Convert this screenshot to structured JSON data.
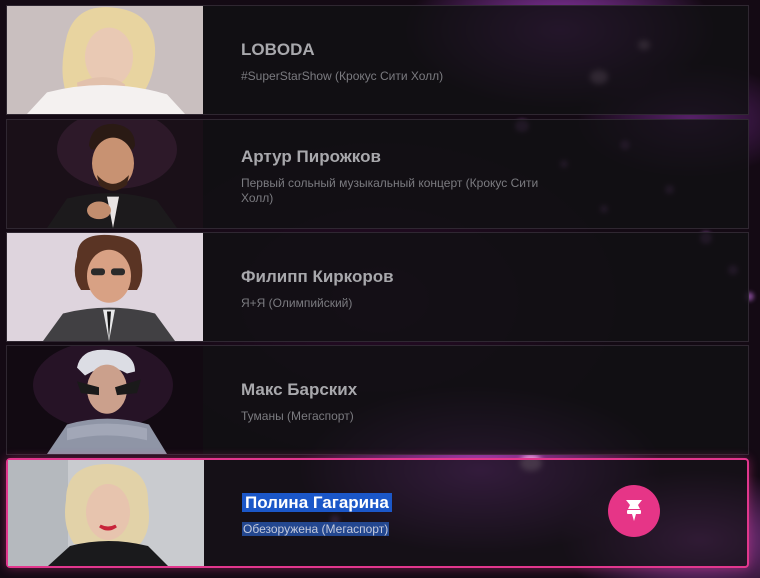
{
  "artists": [
    {
      "name": "LOBODA",
      "show": "#SuperStarShow (Крокус Сити Холл)"
    },
    {
      "name": "Артур Пирожков",
      "show": "Первый сольный музыкальный концерт (Крокус Сити Холл)"
    },
    {
      "name": "Филипп Киркоров",
      "show": "Я+Я (Олимпийский)"
    },
    {
      "name": "Макс Барских",
      "show": "Туманы (Мегаспорт)"
    },
    {
      "name": "Полина Гагарина",
      "show": "Обезоружена (Мегаспорт)"
    }
  ],
  "active_index": 4,
  "action_icon": "pin-icon",
  "colors": {
    "accent": "#e63587",
    "selection": "#1b57c8"
  }
}
